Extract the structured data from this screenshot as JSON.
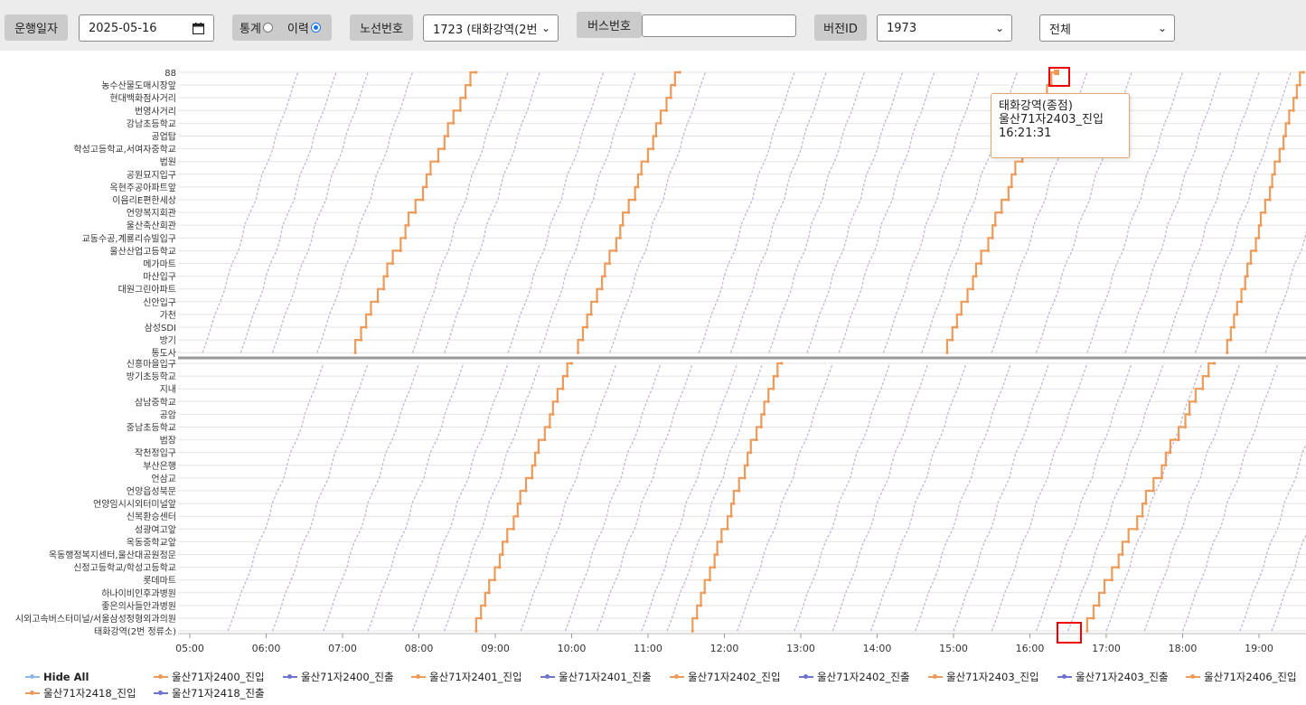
{
  "toolbar": {
    "date_label": "운행일자",
    "date_value": "2025-05-16",
    "mode": {
      "stat_label": "통계",
      "history_label": "이력",
      "selected": "이력"
    },
    "route_label": "노선번호",
    "route_value": "1723 (태화강역(2번",
    "bus_label": "버스번호",
    "bus_value": "",
    "version_label": "버전ID",
    "version_value": "1973",
    "filter_value": "전체"
  },
  "chart_data": {
    "type": "line",
    "x_ticks": [
      "05:00",
      "06:00",
      "07:00",
      "08:00",
      "09:00",
      "10:00",
      "11:00",
      "12:00",
      "13:00",
      "14:00",
      "15:00",
      "16:00",
      "17:00",
      "18:00",
      "19:00"
    ],
    "xlim": [
      "05:00",
      "19:35"
    ],
    "upper_stops": [
      "88",
      "농수산물도매시장앞",
      "현대백화점사거리",
      "번영사거리",
      "강남초등학교",
      "공업탑",
      "학성고등학교,서여자중학교",
      "법원",
      "공원묘지입구",
      "옥현주공아파트앞",
      "이음리E편한세상",
      "언양복지회관",
      "울산축산회관",
      "교동수공,계룡리슈빌입구",
      "울산산업고등학교",
      "메가마트",
      "마산입구",
      "대원그린아파트",
      "신안입구",
      "가천",
      "삼성SDI",
      "방기",
      "통도사"
    ],
    "lower_stops": [
      "신흥마을입구",
      "방기초등학교",
      "지내",
      "삼남중학교",
      "공암",
      "중남초등학교",
      "범장",
      "작천정입구",
      "부산은행",
      "언삼교",
      "언양읍성북문",
      "언양임시시외터미널앞",
      "신복환승센터",
      "성광여고앞",
      "옥동중학교앞",
      "옥동행정복지센터,울산대공원정문",
      "신정고등학교/학성고등학교",
      "롯데마트",
      "하나이비인후과병원",
      "좋은의사들안과병원",
      "시외고속버스터미널/서울삼성정형외과의원",
      "태화강역(2번 정류소)"
    ],
    "series": [
      {
        "name": "울산71자2400_진입",
        "color": "#ec9b5b"
      },
      {
        "name": "울산71자2400_진출",
        "color": "#6f73cf"
      },
      {
        "name": "울산71자2401_진입",
        "color": "#ec9b5b"
      },
      {
        "name": "울산71자2401_진출",
        "color": "#6f73cf"
      },
      {
        "name": "울산71자2402_진입",
        "color": "#ec9b5b"
      },
      {
        "name": "울산71자2402_진출",
        "color": "#6f73cf"
      },
      {
        "name": "울산71자2403_진입",
        "color": "#ec9b5b"
      },
      {
        "name": "울산71자2403_진출",
        "color": "#6f73cf"
      },
      {
        "name": "울산71자2406_진입",
        "color": "#ec9b5b"
      },
      {
        "name": "울산71자2418_진입",
        "color": "#ec9b5b"
      },
      {
        "name": "울산71자2418_진출",
        "color": "#6f73cf"
      }
    ],
    "highlight_trips": [
      {
        "direction": "lower",
        "start": "08:45",
        "end": "10:00"
      },
      {
        "direction": "upper",
        "start": "07:10",
        "end": "08:45"
      },
      {
        "direction": "lower",
        "start": "11:35",
        "end": "12:45"
      },
      {
        "direction": "upper",
        "start": "10:05",
        "end": "11:25"
      },
      {
        "direction": "lower",
        "start": "16:45",
        "end": "18:25"
      },
      {
        "direction": "upper",
        "start": "14:55",
        "end": "16:21"
      },
      {
        "direction": "upper",
        "start": "18:35",
        "end": "19:35"
      }
    ],
    "faint_trips": {
      "upper_starts": [
        "05:10",
        "05:40",
        "06:05",
        "06:40",
        "07:55",
        "08:20",
        "09:10",
        "09:35",
        "10:30",
        "11:40",
        "12:05",
        "12:35",
        "13:05",
        "13:30",
        "14:05",
        "14:35",
        "15:30",
        "16:05",
        "16:45",
        "17:15",
        "17:45",
        "18:10",
        "19:05"
      ],
      "lower_starts": [
        "05:30",
        "06:05",
        "06:45",
        "07:20",
        "07:55",
        "08:20",
        "09:20",
        "09:55",
        "10:20",
        "10:55",
        "11:15",
        "12:10",
        "12:55",
        "13:25",
        "13:55",
        "14:30",
        "15:00",
        "15:30",
        "16:05",
        "16:30",
        "17:00",
        "17:30",
        "18:00",
        "18:45",
        "19:10"
      ],
      "trip_minutes": 75
    },
    "legend_position": "bottom"
  },
  "tooltip": {
    "line1": "태화강역(종점)",
    "line2": "울산71자2403_진입",
    "line3": "16:21:31"
  },
  "legend": {
    "hide_all": "Hide All",
    "items": [
      "울산71자2400_진입",
      "울산71자2400_진출",
      "울산71자2401_진입",
      "울산71자2401_진출",
      "울산71자2402_진입",
      "울산71자2402_진출",
      "울산71자2403_진입",
      "울산71자2403_진출",
      "울산71자2406_진입",
      "울산71자2418_진입",
      "울산71자2418_진출"
    ]
  },
  "colors": {
    "entry": "#ec9b5b",
    "exit": "#6f73cf",
    "divider": "#999999",
    "highlight": "#e00000"
  }
}
